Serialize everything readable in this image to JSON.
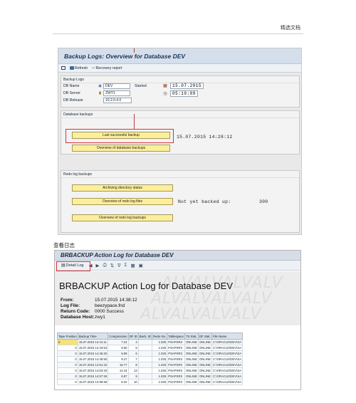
{
  "page_header": "精选文档",
  "screen1": {
    "title": "Backup Logs: Overview for Database DEV",
    "toolbar": {
      "refresh": "Refresh",
      "recovery": "Recovery report"
    },
    "backup_logs": {
      "group_title": "Backup Logs",
      "db_name_label": "DB Name",
      "db_name": "DEV",
      "status": "Started",
      "db_server_label": "DB Server",
      "db_server": "ZWY1",
      "db_release_label": "DB Release",
      "db_release": "10.2.0.4.0",
      "date": "15.07.2015",
      "time": "05:19:09"
    },
    "database_backups": {
      "group_title": "Database backups",
      "last_successful": "Last successful backup",
      "last_value": "15.07.2015 14:28:12",
      "overview": "Overview of database backups"
    },
    "redo": {
      "group_title": "Redo log backups",
      "archiving": "Archiving directory status",
      "overview_files": "Overview of redo log files",
      "not_backed": "Not yet backed up:",
      "count": "300",
      "overview_backups": "Overview of redo log backups"
    }
  },
  "caption": "查看日志",
  "screen2": {
    "title": "BRBACKUP Action Log for Database DEV",
    "toolbar": {
      "detail": "Detail Log"
    },
    "heading": "BRBACKUP Action Log for Database DEV",
    "watermark": "ALVALVALVALV",
    "from_label": "From:",
    "from": "15.07.2015 14:38:12",
    "logfile_label": "Log File:",
    "logfile": "beezypace.fnd",
    "return_label": "Return Code:",
    "return": "0000 Success",
    "host_label": "Database Host:",
    "host": "zwy1",
    "columns": [
      "Tape Position",
      "Backup Time",
      "Compression",
      "DF ID",
      "Back. ID",
      "Redo No.",
      "Tablespace",
      "TS Stat.",
      "DF Stat.",
      "File Name"
    ],
    "rows": [
      [
        "0",
        "15.07.2015 14:41:11",
        "7.24",
        "4",
        "",
        "1.025",
        "PSAPSR3",
        "ONLINE",
        "ONLINE",
        "C:\\ORACLE\\DEV\\SA"
      ],
      [
        "0",
        "15.07.2015 14:43:54",
        "8.60",
        "5",
        "",
        "1.025",
        "PSAPSR3",
        "ONLINE",
        "ONLINE",
        "C:\\ORACLE\\DEV\\SA"
      ],
      [
        "0",
        "15.07.2015 14:46:20",
        "9.09",
        "6",
        "",
        "1.025",
        "PSAPSR3",
        "ONLINE",
        "ONLINE",
        "C:\\ORACLE\\DEV\\SA"
      ],
      [
        "0",
        "15.07.2015 14:48:50",
        "9.27",
        "7",
        "",
        "1.025",
        "PSAPSR3",
        "ONLINE",
        "ONLINE",
        "C:\\ORACLE\\DEV\\SA"
      ],
      [
        "0",
        "15.07.2015 14:51:22",
        "15.77",
        "8",
        "",
        "1.025",
        "PSAPSR3",
        "ONLINE",
        "ONLINE",
        "C:\\ORACLE\\DEV\\SA"
      ],
      [
        "0",
        "15.07.2015 14:53:33",
        "14.44",
        "13",
        "",
        "1.025",
        "PSAPSR3",
        "ONLINE",
        "ONLINE",
        "C:\\ORACLE\\DEV\\SA"
      ],
      [
        "0",
        "15.07.2015 14:57:25",
        "8.87",
        "9",
        "",
        "1.025",
        "PSAPSR3",
        "ONLINE",
        "ONLINE",
        "C:\\ORACLE\\DEV\\SA"
      ],
      [
        "0",
        "15.07.2015 14:59:59",
        "8.42",
        "10",
        "",
        "1.025",
        "PSAPSR3",
        "ONLINE",
        "ONLINE",
        "C:\\ORACLE\\DEV\\SA"
      ]
    ]
  }
}
